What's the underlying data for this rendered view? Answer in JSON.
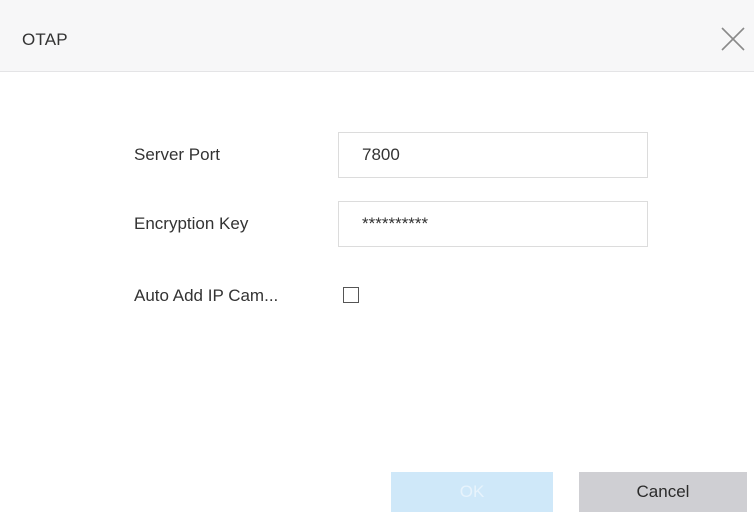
{
  "dialog": {
    "title": "OTAP",
    "close_icon": "close-icon"
  },
  "form": {
    "server_port": {
      "label": "Server Port",
      "value": "7800"
    },
    "encryption_key": {
      "label": "Encryption Key",
      "value": "**********"
    },
    "auto_add": {
      "label": "Auto Add IP Cam...",
      "checked": false
    }
  },
  "buttons": {
    "ok_label": "OK",
    "cancel_label": "Cancel"
  },
  "colors": {
    "ok_disabled_bg": "#cfe8f9",
    "cancel_bg": "#cfcfd3",
    "title_bar_bg": "#f7f7f8"
  }
}
